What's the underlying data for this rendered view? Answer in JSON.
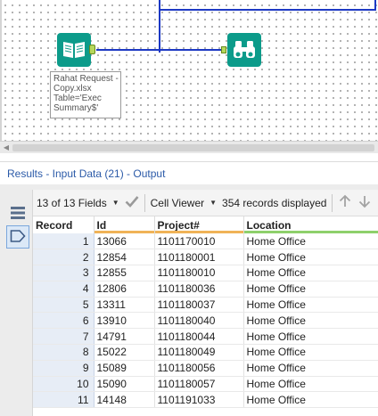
{
  "canvas": {
    "input_tool": {
      "icon": "open-book-icon"
    },
    "browse_tool": {
      "icon": "binoculars-icon"
    },
    "annotation_lines": [
      "Rahat Request -",
      "Copy.xlsx",
      "Table='Exec",
      "Summary$'"
    ]
  },
  "results": {
    "title": "Results - Input Data (21) - Output"
  },
  "toolbar": {
    "fields_label": "13 of 13 Fields",
    "viewer_label": "Cell Viewer",
    "records_label": "354 records displayed"
  },
  "table": {
    "columns": [
      {
        "label": "Record",
        "type_color": ""
      },
      {
        "label": "Id",
        "type_color": "#f0b357"
      },
      {
        "label": "Project#",
        "type_color": "#f0b357"
      },
      {
        "label": "Location",
        "type_color": "#8ed06b"
      }
    ],
    "rows": [
      {
        "record": "1",
        "id": "13066",
        "project": "1101170010",
        "location": "Home Office"
      },
      {
        "record": "2",
        "id": "12854",
        "project": "1101180001",
        "location": "Home Office"
      },
      {
        "record": "3",
        "id": "12855",
        "project": "1101180010",
        "location": "Home Office"
      },
      {
        "record": "4",
        "id": "12806",
        "project": "1101180036",
        "location": "Home Office"
      },
      {
        "record": "5",
        "id": "13311",
        "project": "1101180037",
        "location": "Home Office"
      },
      {
        "record": "6",
        "id": "13910",
        "project": "1101180040",
        "location": "Home Office"
      },
      {
        "record": "7",
        "id": "14791",
        "project": "1101180044",
        "location": "Home Office"
      },
      {
        "record": "8",
        "id": "15022",
        "project": "1101180049",
        "location": "Home Office"
      },
      {
        "record": "9",
        "id": "15089",
        "project": "1101180056",
        "location": "Home Office"
      },
      {
        "record": "10",
        "id": "15090",
        "project": "1101180057",
        "location": "Home Office"
      },
      {
        "record": "11",
        "id": "14148",
        "project": "1101191033",
        "location": "Home Office"
      }
    ]
  },
  "colors": {
    "wire": "#1d39c4",
    "tool": "#0c9b8a",
    "results_title": "#2b5aa8",
    "record_column": "#e7edf6"
  }
}
